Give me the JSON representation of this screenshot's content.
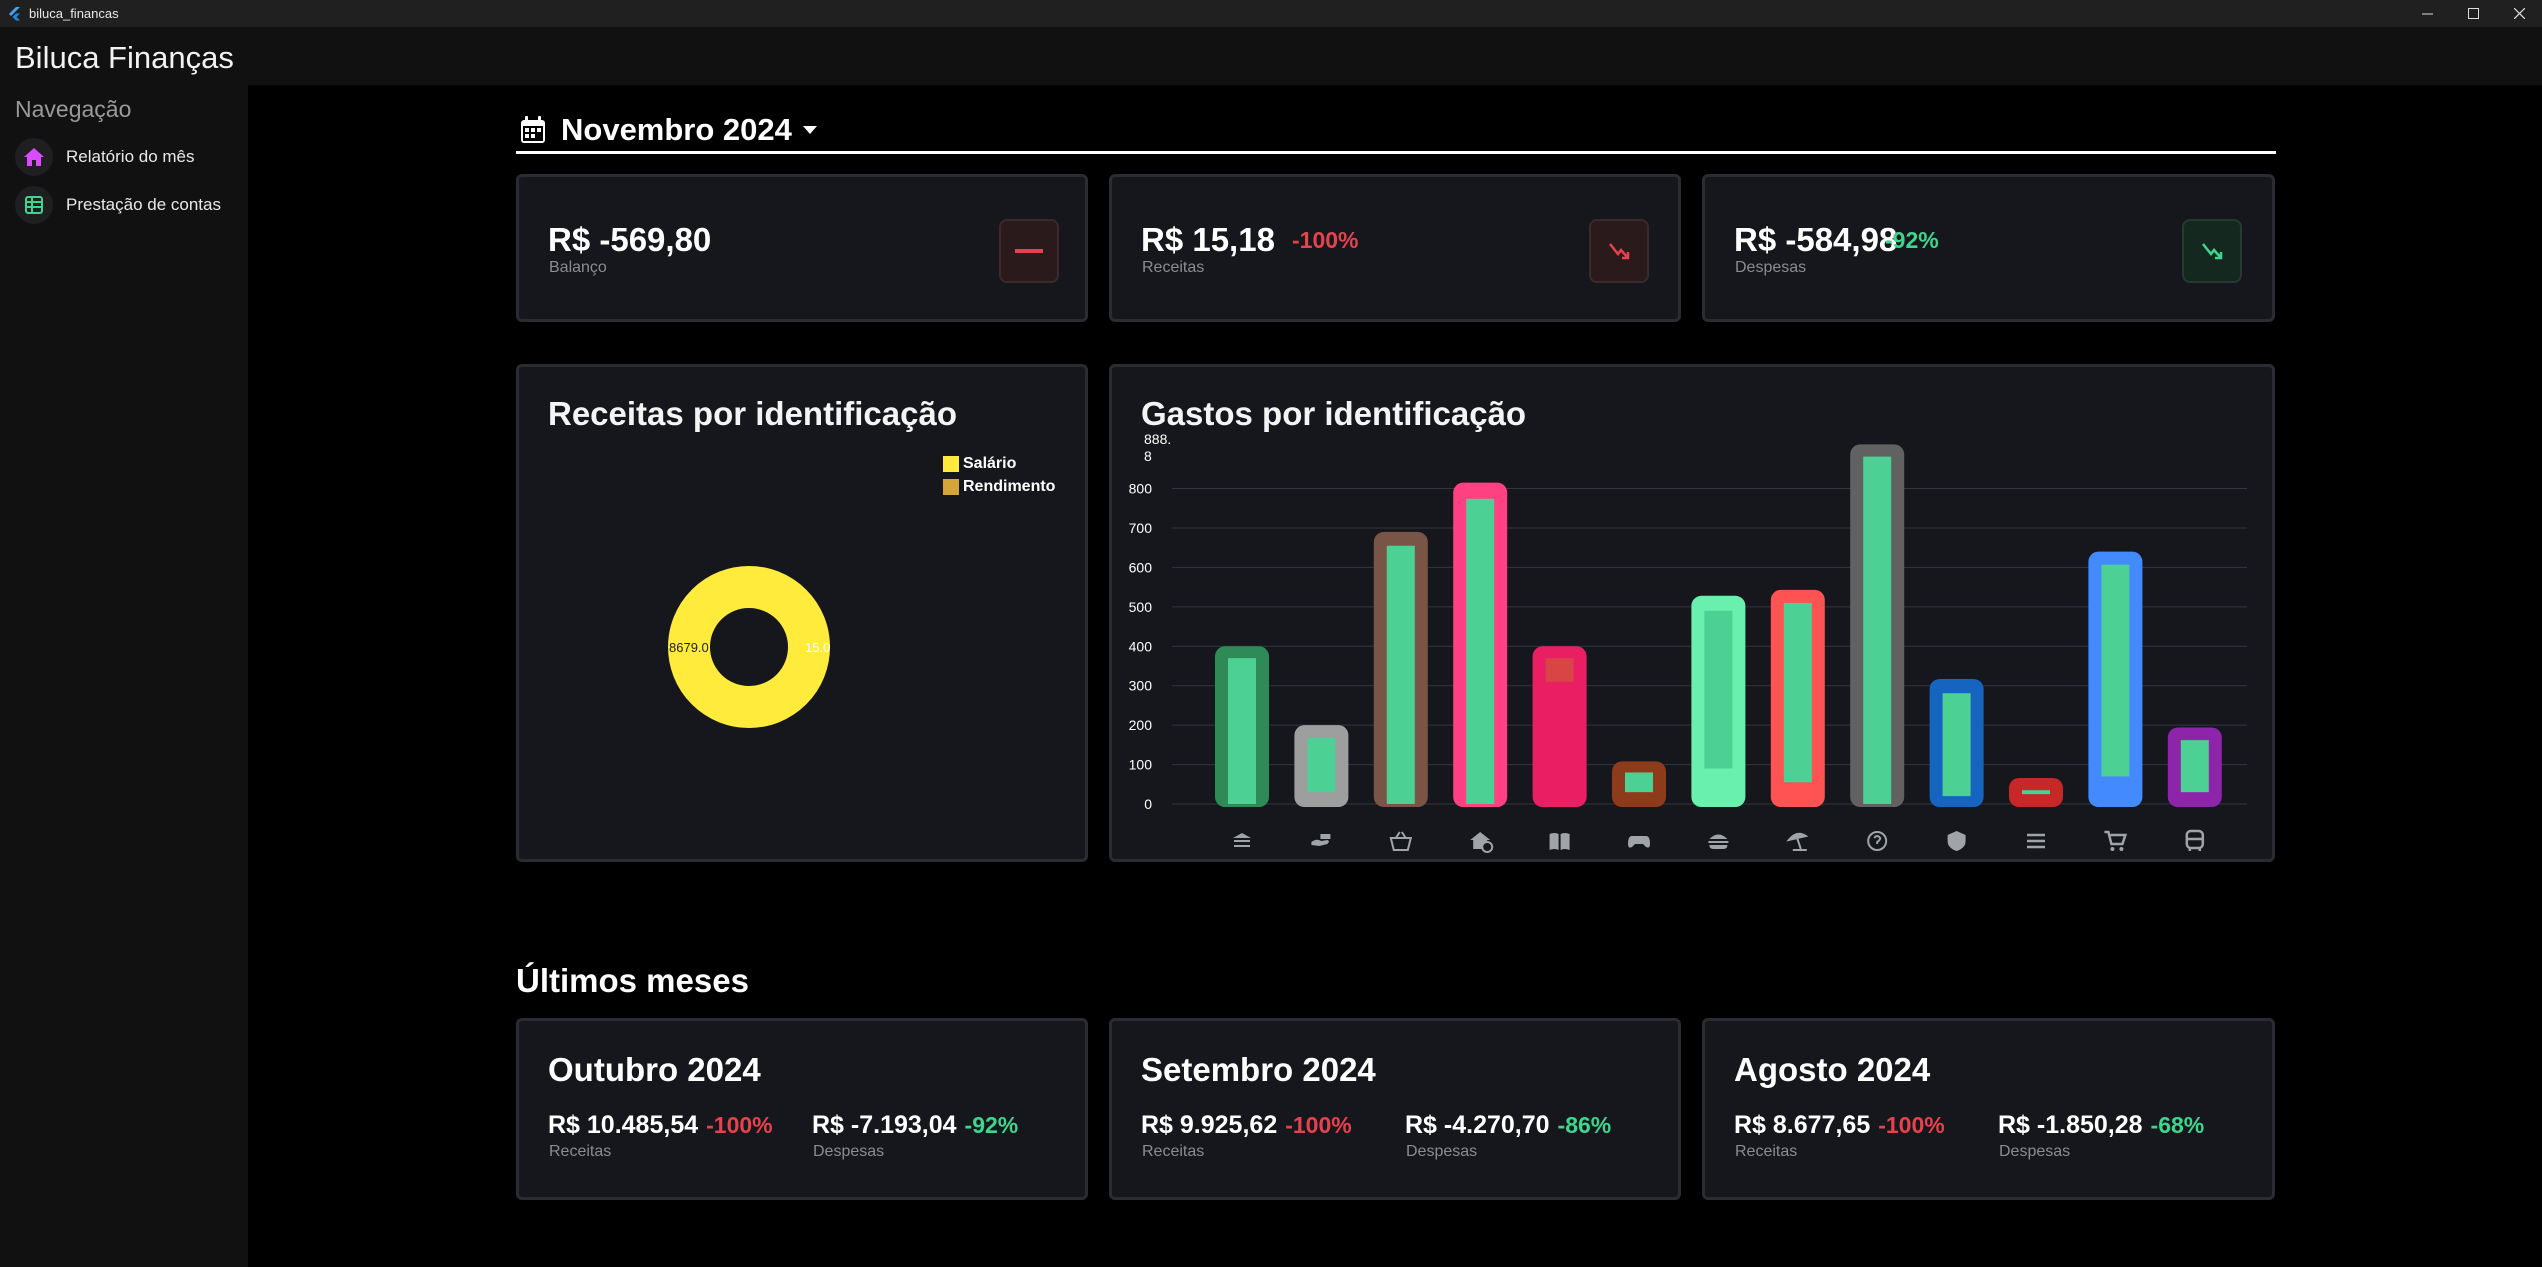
{
  "window": {
    "title": "biluca_financas"
  },
  "app": {
    "title": "Biluca Finanças"
  },
  "sidebar": {
    "heading": "Navegação",
    "items": [
      {
        "label": "Relatório do mês",
        "icon": "home-icon",
        "color": "#d94bff"
      },
      {
        "label": "Prestação de contas",
        "icon": "table-icon",
        "color": "#3dd68c"
      }
    ]
  },
  "month": {
    "label": "Novembro 2024"
  },
  "summary": {
    "balance": {
      "value": "R$ -569,80",
      "label": "Balanço",
      "icon": "minus-icon"
    },
    "income": {
      "value": "R$ 15,18",
      "pct": "-100%",
      "label": "Receitas",
      "icon": "trend-down-icon"
    },
    "expenses": {
      "value": "R$ -584,98",
      "pct": "-92%",
      "label": "Despesas",
      "icon": "trend-down-icon"
    }
  },
  "income_chart": {
    "title": "Receitas por identificação",
    "legend": [
      {
        "name": "Salário",
        "color": "#ffeb3b"
      },
      {
        "name": "Rendimento",
        "color": "#d4a537"
      }
    ],
    "slice_labels": [
      "8679.0",
      "15.0"
    ]
  },
  "expenses_chart": {
    "title": "Gastos por identificação",
    "max_label_line1": "888.",
    "max_label_line2": "8"
  },
  "chart_data": {
    "type": "bar",
    "title": "Gastos por identificação",
    "ylim": [
      0,
      888.8
    ],
    "yticks": [
      0,
      100,
      200,
      300,
      400,
      500,
      600,
      700,
      800
    ],
    "grid": true,
    "categories": [
      "bank",
      "hand-payment",
      "basket",
      "home-time",
      "book",
      "gamepad",
      "burger",
      "beach",
      "help",
      "shield",
      "list",
      "cart",
      "bus"
    ],
    "series": [
      {
        "values": [
          400,
          200,
          690,
          815,
          400,
          108,
          528,
          543,
          912,
          317,
          66,
          640,
          194
        ],
        "colors": [
          "#2e8b57",
          "#9e9e9e",
          "#795548",
          "#ff4081",
          "#e91e63",
          "#8d3b1a",
          "#69f0ae",
          "#ff5252",
          "#616161",
          "#1565c0",
          "#c62828",
          "#448aff",
          "#8e24aa"
        ]
      },
      {
        "ranges": [
          [
            0,
            370
          ],
          [
            30,
            168
          ],
          [
            0,
            655
          ],
          [
            0,
            774
          ],
          [
            310,
            370
          ],
          [
            30,
            80
          ],
          [
            90,
            490
          ],
          [
            55,
            510
          ],
          [
            0,
            881
          ],
          [
            20,
            281
          ],
          [
            25,
            35
          ],
          [
            70,
            607
          ],
          [
            30,
            162
          ]
        ],
        "color": "#4cd093"
      }
    ]
  },
  "history": {
    "title": "Últimos meses",
    "months": [
      {
        "name": "Outubro 2024",
        "income": "R$ 10.485,54",
        "income_pct": "-100%",
        "income_label": "Receitas",
        "expense": "R$ -7.193,04",
        "expense_pct": "-92%",
        "expense_label": "Despesas"
      },
      {
        "name": "Setembro 2024",
        "income": "R$ 9.925,62",
        "income_pct": "-100%",
        "income_label": "Receitas",
        "expense": "R$ -4.270,70",
        "expense_pct": "-86%",
        "expense_label": "Despesas"
      },
      {
        "name": "Agosto 2024",
        "income": "R$ 8.677,65",
        "income_pct": "-100%",
        "income_label": "Receitas",
        "expense": "R$ -1.850,28",
        "expense_pct": "-68%",
        "expense_label": "Despesas"
      }
    ]
  }
}
